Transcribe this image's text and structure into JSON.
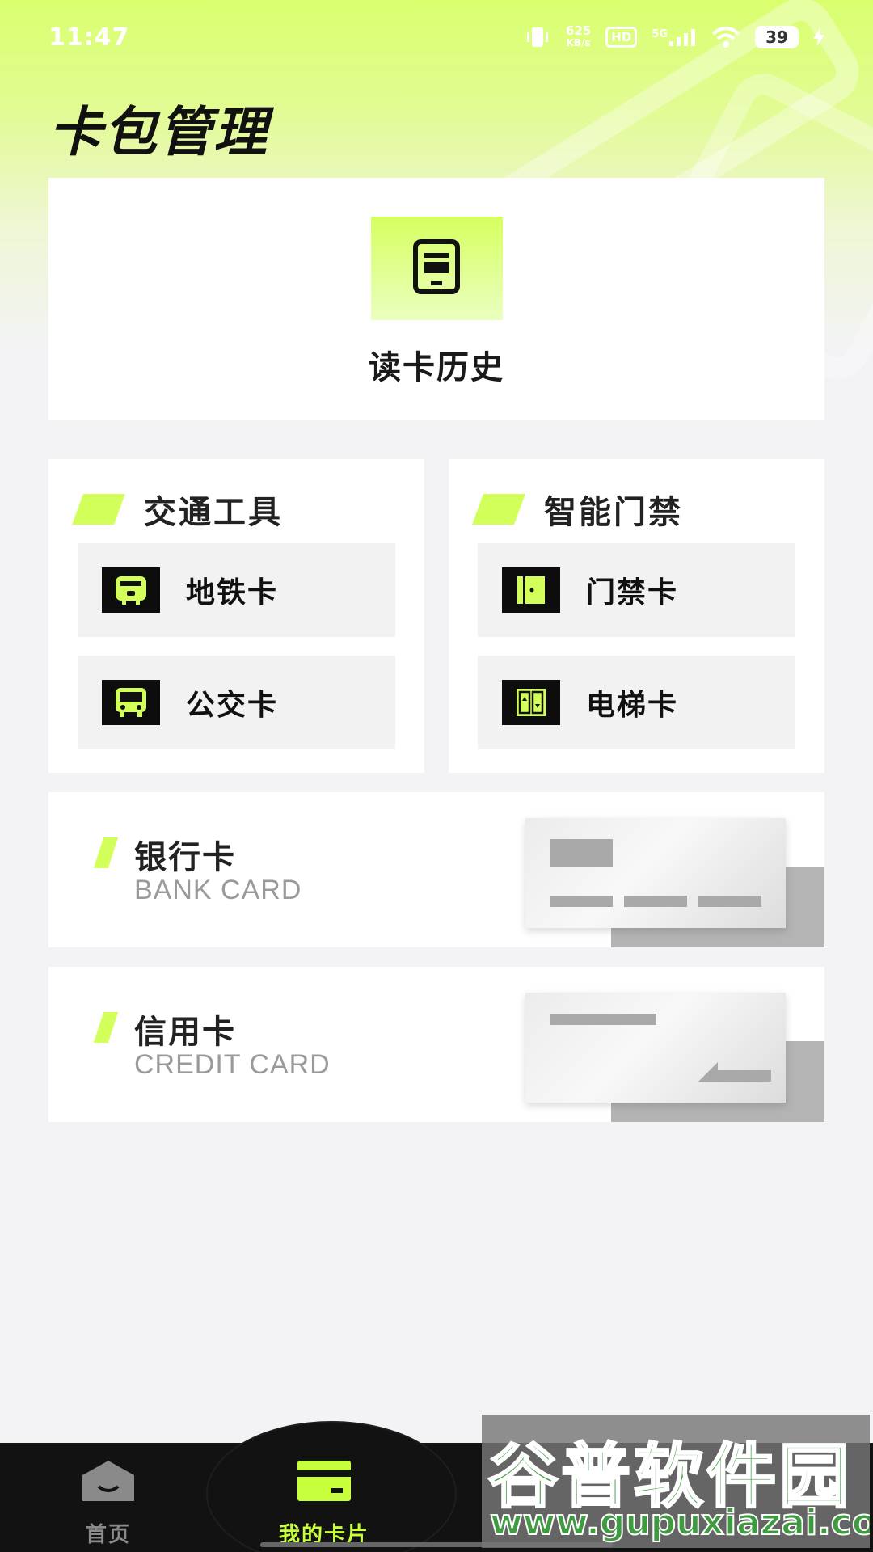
{
  "status_bar": {
    "time": "11:47",
    "net_speed_value": "625",
    "net_speed_unit": "KB/s",
    "hd_label": "HD",
    "signal_label": "5G",
    "battery": "39"
  },
  "page": {
    "title": "卡包管理"
  },
  "history": {
    "label": "读卡历史",
    "icon": "phone-card-icon"
  },
  "panels": {
    "transport": {
      "title": "交通工具",
      "items": [
        {
          "label": "地铁卡",
          "icon": "metro-icon"
        },
        {
          "label": "公交卡",
          "icon": "bus-icon"
        }
      ]
    },
    "access": {
      "title": "智能门禁",
      "items": [
        {
          "label": "门禁卡",
          "icon": "door-icon"
        },
        {
          "label": "电梯卡",
          "icon": "elevator-icon"
        }
      ]
    }
  },
  "bank_cards": [
    {
      "title": "银行卡",
      "subtitle": "BANK CARD"
    },
    {
      "title": "信用卡",
      "subtitle": "CREDIT CARD"
    }
  ],
  "bottom_nav": {
    "items": [
      {
        "label": "首页",
        "icon": "home-icon",
        "active": false
      },
      {
        "label": "我的卡片",
        "icon": "card-icon",
        "active": true
      }
    ]
  },
  "watermark": {
    "brand": "谷普软件园",
    "url": "www.gupuxiazai.com"
  },
  "colors": {
    "accent": "#d3ff5a",
    "nav_active": "#c7ff3c",
    "nav_bg": "#121212",
    "page_bg": "#f3f3f6"
  }
}
